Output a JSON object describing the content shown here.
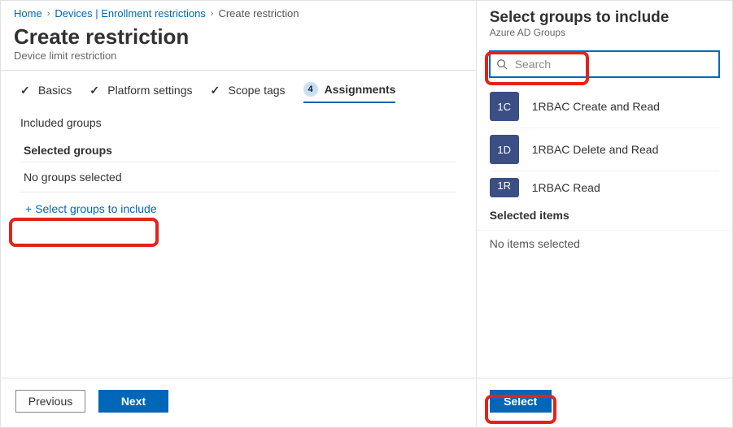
{
  "breadcrumb": {
    "items": [
      {
        "label": "Home",
        "link": true
      },
      {
        "label": "Devices | Enrollment restrictions",
        "link": true
      },
      {
        "label": "Create restriction",
        "link": false
      }
    ]
  },
  "page": {
    "title": "Create restriction",
    "subtitle": "Device limit restriction"
  },
  "steps": [
    {
      "label": "Basics",
      "done": true
    },
    {
      "label": "Platform settings",
      "done": true
    },
    {
      "label": "Scope tags",
      "done": true
    },
    {
      "label": "Assignments",
      "num": "4",
      "current": true
    }
  ],
  "content": {
    "section": "Included groups",
    "selected_head": "Selected groups",
    "empty": "No groups selected",
    "add_link": "Select groups to include"
  },
  "footer": {
    "previous": "Previous",
    "next": "Next"
  },
  "side": {
    "title": "Select groups to include",
    "subtitle": "Azure AD Groups",
    "search_placeholder": "Search",
    "groups": [
      {
        "initials": "1C",
        "name": "1RBAC Create and Read"
      },
      {
        "initials": "1D",
        "name": "1RBAC Delete and Read"
      },
      {
        "initials": "1R",
        "name": "1RBAC Read"
      }
    ],
    "selected_head": "Selected items",
    "empty": "No items selected",
    "select_btn": "Select"
  }
}
